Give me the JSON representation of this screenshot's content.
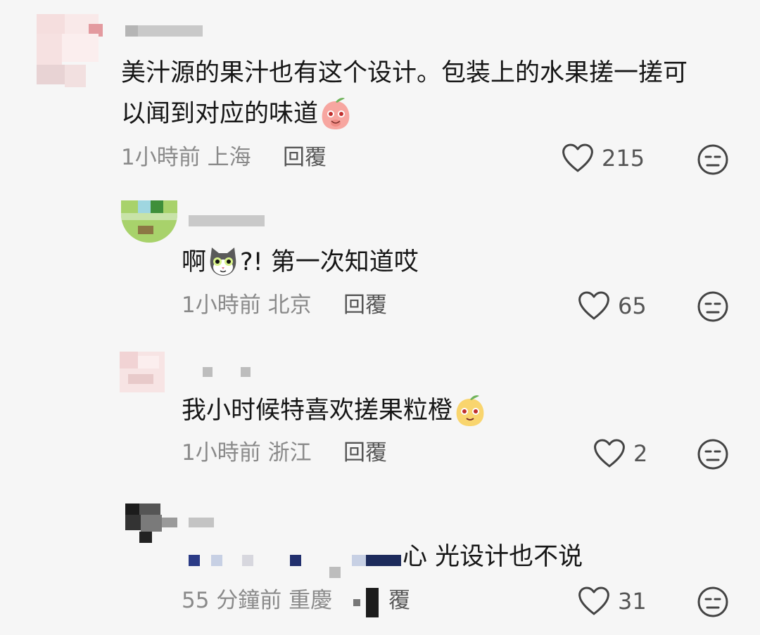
{
  "comments": [
    {
      "text": "美汁源的果汁也有这个设计。包装上的水果搓一搓可",
      "text2": "以闻到对应的味道",
      "time": "1小時前",
      "location": "上海",
      "reply": "回覆",
      "likes": "215",
      "emoji_icon": "peach-face-emoji-icon"
    },
    {
      "text_pre": "啊",
      "text_post": "?! 第一次知道哎",
      "time": "1小時前",
      "location": "北京",
      "reply": "回覆",
      "likes": "65",
      "emoji_icon": "cat-face-emoji-icon"
    },
    {
      "text": "我小时候特喜欢搓果粒橙",
      "time": "1小時前",
      "location": "浙江",
      "reply": "回覆",
      "likes": "2",
      "emoji_icon": "orange-face-emoji-icon"
    },
    {
      "text_visible": "心 光设计也不说",
      "time": "55 分鐘前",
      "location": "重慶",
      "reply_partial": "覆",
      "likes": "31"
    }
  ],
  "icons": {
    "like": "heart-outline-icon",
    "dislike": "neutral-face-icon"
  },
  "colors": {
    "text": "#161616",
    "meta": "#8a8a8a",
    "icon": "#444444"
  }
}
